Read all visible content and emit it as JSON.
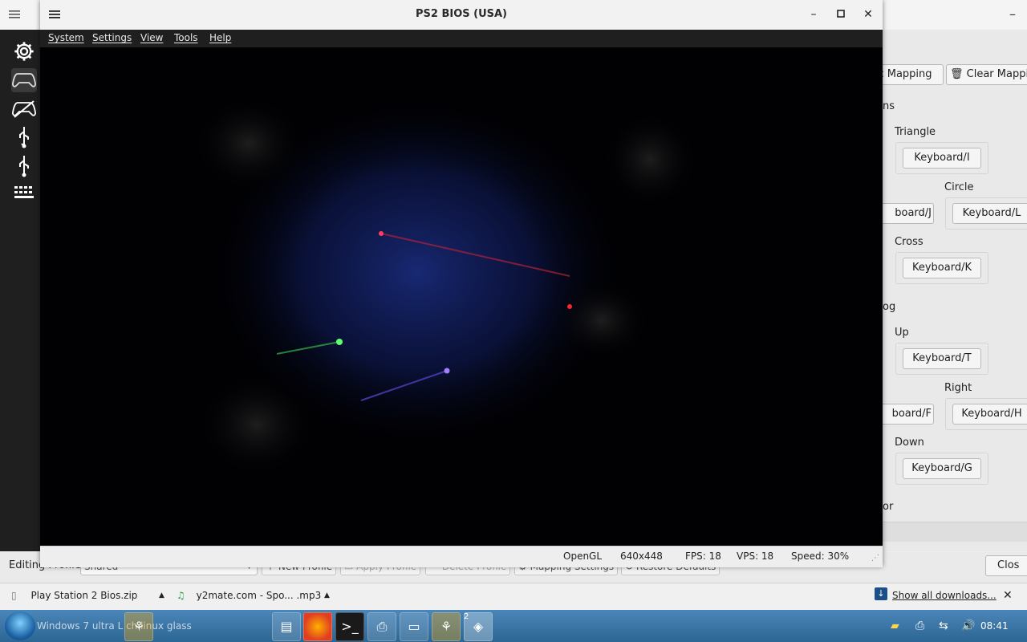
{
  "back_window": {
    "buttons": {
      "automatic_mapping": "c Mapping",
      "clear_mapping": "Clear Mapping"
    },
    "sections": [
      {
        "title": "ns",
        "fields": [
          {
            "label": "Triangle",
            "binding": "Keyboard/I"
          },
          {
            "label": "Circle",
            "binding": "Keyboard/L",
            "left_binding": "board/J"
          },
          {
            "label": "Cross",
            "binding": "Keyboard/K"
          }
        ]
      },
      {
        "title": "og",
        "fields": [
          {
            "label": "Up",
            "binding": "Keyboard/T"
          },
          {
            "label": "Right",
            "binding": "Keyboard/H",
            "left_binding": "board/F"
          },
          {
            "label": "Down",
            "binding": "Keyboard/G"
          }
        ]
      },
      {
        "title": "or"
      }
    ],
    "bottom": {
      "editing_label": "Editing Profile:",
      "profile": "Shared",
      "new_profile": "New Profile",
      "apply_profile": "Apply Profile",
      "delete_profile": "Delete Profile",
      "mapping_settings": "Mapping Settings",
      "restore_defaults": "Restore Defaults",
      "close": "Clos"
    }
  },
  "pcsx2": {
    "title": "PS2 BIOS (USA)",
    "menu": [
      "System",
      "Settings",
      "View",
      "Tools",
      "Help"
    ],
    "status": {
      "renderer": "OpenGL",
      "resolution": "640x448",
      "fps": "FPS: 18",
      "vps": "VPS: 18",
      "speed": "Speed: 30%"
    }
  },
  "downloads": {
    "items": [
      {
        "name": "Play Station 2 Bios.zip"
      },
      {
        "name": "y2mate.com - Spo... .mp3"
      }
    ],
    "show_all": "Show all downloads..."
  },
  "taskbar": {
    "start_label": "Windows 7 ultra L   ch linux glass",
    "badge": "2",
    "clock": "08:41"
  },
  "colors": {
    "accent": "#2c6694",
    "dark_sidebar": "#1f1f1f",
    "display_bg": "#010104"
  }
}
